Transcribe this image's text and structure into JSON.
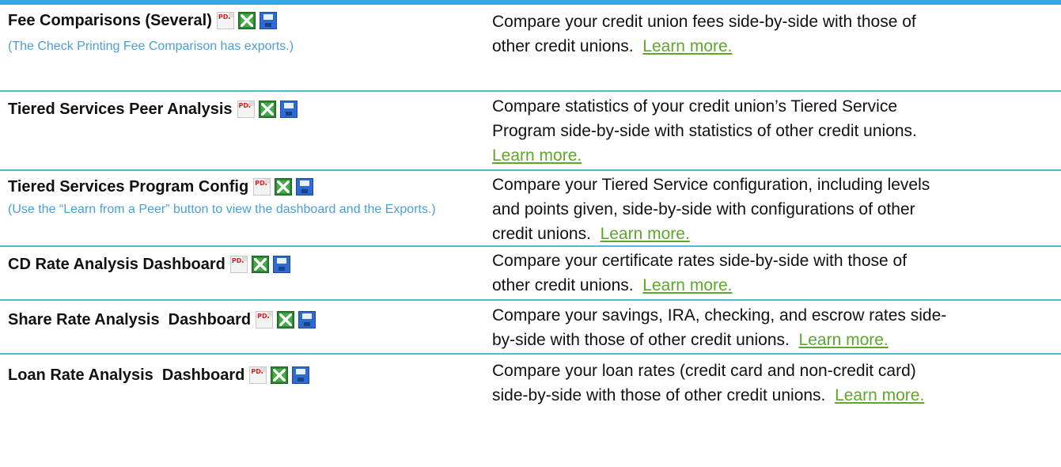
{
  "icon_names": [
    "pdf-icon",
    "excel-icon",
    "save-icon"
  ],
  "pdf_icon_text": "PDF",
  "colors": {
    "top_bar": "#3aa6dd",
    "divider": "#53b9d8",
    "note_text": "#4a9fd8",
    "link": "#5da82a"
  },
  "learn_more": "Learn more.",
  "rows": [
    {
      "title": "Fee Comparisons (Several)",
      "note": "(The Check Printing Fee Comparison has exports.)",
      "desc_lines": [
        "Compare your credit union fees side-by-side with those of",
        "other credit unions.  "
      ]
    },
    {
      "title": "Tiered Services Peer Analysis",
      "note": "",
      "desc_lines": [
        "Compare statistics of your credit union’s Tiered Service",
        "Program side-by-side with statistics of other credit unions.",
        ""
      ]
    },
    {
      "title": "Tiered Services Program Config",
      "note": "(Use the “Learn from a Peer” button to view the dashboard and the Exports.)",
      "desc_lines": [
        "Compare your Tiered Service configuration, including levels",
        "and points given, side-by-side with configurations of other",
        "credit unions.  "
      ]
    },
    {
      "title": "CD Rate Analysis Dashboard",
      "note": "",
      "desc_lines": [
        "Compare your certificate rates side-by-side with those of",
        "other credit unions.  "
      ]
    },
    {
      "title": "Share Rate Analysis  Dashboard",
      "note": "",
      "desc_lines": [
        "Compare your savings, IRA, checking, and escrow rates side-",
        "by-side with those of other credit unions.  "
      ]
    },
    {
      "title": "Loan Rate Analysis  Dashboard",
      "note": "",
      "desc_lines": [
        "Compare your loan rates (credit card and non-credit card)",
        "side-by-side with those of other credit unions.  "
      ]
    }
  ]
}
